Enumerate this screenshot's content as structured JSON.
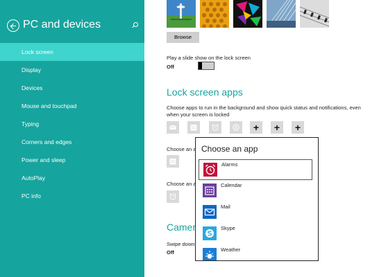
{
  "sidebar": {
    "title": "PC and devices",
    "items": [
      {
        "label": "Lock screen",
        "active": true
      },
      {
        "label": "Display"
      },
      {
        "label": "Devices"
      },
      {
        "label": "Mouse and touchpad"
      },
      {
        "label": "Typing"
      },
      {
        "label": "Corners and edges"
      },
      {
        "label": "Power and sleep"
      },
      {
        "label": "AutoPlay"
      },
      {
        "label": "PC info"
      }
    ]
  },
  "main": {
    "browse_label": "Browse",
    "slideshow_label": "Play a slide show on the lock screen",
    "slideshow_state": "Off",
    "lock_screen_apps_title": "Lock screen apps",
    "lock_screen_apps_desc": "Choose apps to run in the background and show quick status and notifications, even when your screen is locked",
    "choose_app_label_1": "Choose an a",
    "choose_app_label_2": "Choose an a",
    "camera_title": "Camer",
    "swipe_label": "Swipe down",
    "camera_state": "Off",
    "plus_glyph": "+"
  },
  "popup": {
    "title": "Choose an app",
    "apps": [
      {
        "name": "Alarms",
        "color": "#c4123b"
      },
      {
        "name": "Calendar",
        "color": "#6a3fa0"
      },
      {
        "name": "Mail",
        "color": "#0f66c5"
      },
      {
        "name": "Skype",
        "color": "#2aa8e0"
      },
      {
        "name": "Weather",
        "color": "#1a7ed6"
      }
    ]
  },
  "colors": {
    "accent": "#16a49e",
    "sidebar_active": "#3fd4ce"
  }
}
